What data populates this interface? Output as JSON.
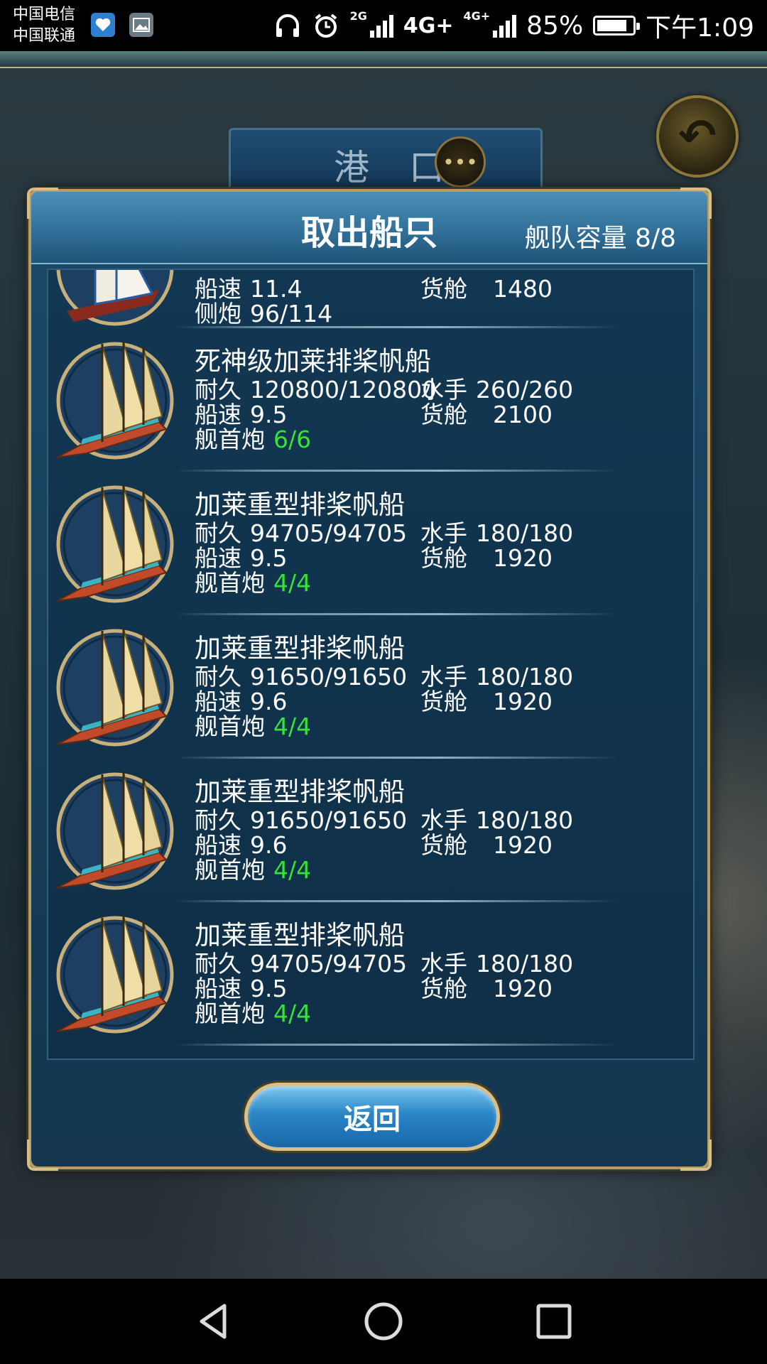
{
  "status_bar": {
    "carrier_1": "中国电信",
    "carrier_2": "中国联通",
    "network_small": "2G",
    "network_main": "4G+",
    "network_sup": "4G+",
    "battery_percent": "85%",
    "battery_level": 0.85,
    "time": "下午1:09"
  },
  "background": {
    "port_title": "港 口"
  },
  "dialog": {
    "title": "取出船只",
    "fleet_capacity": "舰队容量 8/8",
    "return_label": "返回"
  },
  "partial_ship": {
    "speed_label": "船速",
    "speed": "11.4",
    "cargo_label": "货舱",
    "cargo": "1480",
    "gun_label": "侧炮",
    "guns": "96/114"
  },
  "ships": [
    {
      "name": "死神级加莱排桨帆船",
      "dur_label": "耐久",
      "durability": "120800/120800",
      "crew_label": "水手",
      "crew": "260/260",
      "speed_label": "船速",
      "speed": "9.5",
      "cargo_label": "货舱",
      "cargo": "2100",
      "gun_label": "舰首炮",
      "guns": "6/6"
    },
    {
      "name": "加莱重型排桨帆船",
      "dur_label": "耐久",
      "durability": "94705/94705",
      "crew_label": "水手",
      "crew": "180/180",
      "speed_label": "船速",
      "speed": "9.5",
      "cargo_label": "货舱",
      "cargo": "1920",
      "gun_label": "舰首炮",
      "guns": "4/4"
    },
    {
      "name": "加莱重型排桨帆船",
      "dur_label": "耐久",
      "durability": "91650/91650",
      "crew_label": "水手",
      "crew": "180/180",
      "speed_label": "船速",
      "speed": "9.6",
      "cargo_label": "货舱",
      "cargo": "1920",
      "gun_label": "舰首炮",
      "guns": "4/4"
    },
    {
      "name": "加莱重型排桨帆船",
      "dur_label": "耐久",
      "durability": "91650/91650",
      "crew_label": "水手",
      "crew": "180/180",
      "speed_label": "船速",
      "speed": "9.6",
      "cargo_label": "货舱",
      "cargo": "1920",
      "gun_label": "舰首炮",
      "guns": "4/4"
    },
    {
      "name": "加莱重型排桨帆船",
      "dur_label": "耐久",
      "durability": "94705/94705",
      "crew_label": "水手",
      "crew": "180/180",
      "speed_label": "船速",
      "speed": "9.5",
      "cargo_label": "货舱",
      "cargo": "1920",
      "gun_label": "舰首炮",
      "guns": "4/4"
    }
  ],
  "colors": {
    "highlight_green": "#35e235",
    "frame_gold": "#b59b66",
    "panel_blue": "#173f5a"
  },
  "icons": {
    "back": "curved-back-arrow-icon",
    "chat": "chat-bubble-icon",
    "nav_back": "triangle-back-icon",
    "nav_home": "circle-home-icon",
    "nav_recent": "square-recent-icon"
  }
}
